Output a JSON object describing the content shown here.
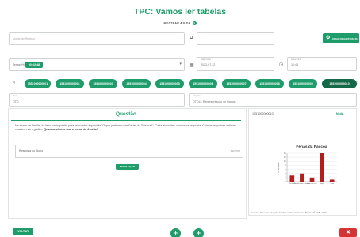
{
  "header": {
    "title": "TPC: Vamos ler tabelas",
    "help_label": "MOSTRAR AJUDA",
    "help_icon": "?"
  },
  "form": {
    "name_field": {
      "label": "Nome do Registo",
      "placeholder": "Nome do Registo"
    },
    "second_field": {
      "label": "",
      "value": ""
    },
    "button_label": "CRIAR REGISTO(S) ID",
    "time_field": {
      "label": "Tempo/Hora",
      "value": "00:02:48"
    },
    "start_date": {
      "label": "Data Início",
      "value": "2023-07-12"
    },
    "start_time": {
      "label": "Hora Início",
      "value": "10:48"
    }
  },
  "pills": [
    {
      "label": "1551000000001"
    },
    {
      "label": "1551000000001"
    },
    {
      "label": "1551000000003"
    },
    {
      "label": "1551000000004"
    },
    {
      "label": "1551000000005"
    },
    {
      "label": "1551000000006"
    },
    {
      "label": "1551000000007"
    },
    {
      "label": "1551000000008"
    },
    {
      "label": "1551000000009"
    },
    {
      "label": "1551000000010"
    }
  ],
  "meta": {
    "type": {
      "label": "Tipo",
      "value": "OTD"
    },
    "subject": {
      "label": "Assunto",
      "value": "OTD4 - Representação de Dados"
    }
  },
  "question": {
    "title": "Questão",
    "text": "Na turma da Amélia, foi feito um inquérito para responder à questão \"O que preferem nas Férias da Páscoa?\". Cada aluno deu uma única resposta. Com as respostas obtidas, construiu-se o gráfico.",
    "text_bold": "Quantos alunos tem a turma da Amélia?",
    "answer_label": "Resposta do Aluno",
    "answer_hint": "escrever",
    "submit_label": "RESOLUÇÃO"
  },
  "chart_panel": {
    "code": "1551000000010",
    "score": "Média",
    "source": "Caderno Prova de Aferição de Matemática do Ensino Básico 3º CEB, 2006"
  },
  "footer": {
    "back_label": "VOLTAR",
    "add_icon": "+",
    "trash_icon": "✖"
  },
  "chart_data": {
    "type": "bar",
    "title": "Férias da Páscoa",
    "categories": [
      "Ver filmes",
      "Passear com os amigos",
      "Ficar em casa",
      "Viajar",
      "Outra"
    ],
    "values": [
      3,
      4,
      2,
      14,
      1
    ],
    "ylim": [
      0,
      14
    ],
    "yticks": [
      0,
      2,
      4,
      6,
      8,
      10,
      12,
      14
    ],
    "ylabel": "N.º de alunos",
    "bar_color": "#b21e1e"
  }
}
